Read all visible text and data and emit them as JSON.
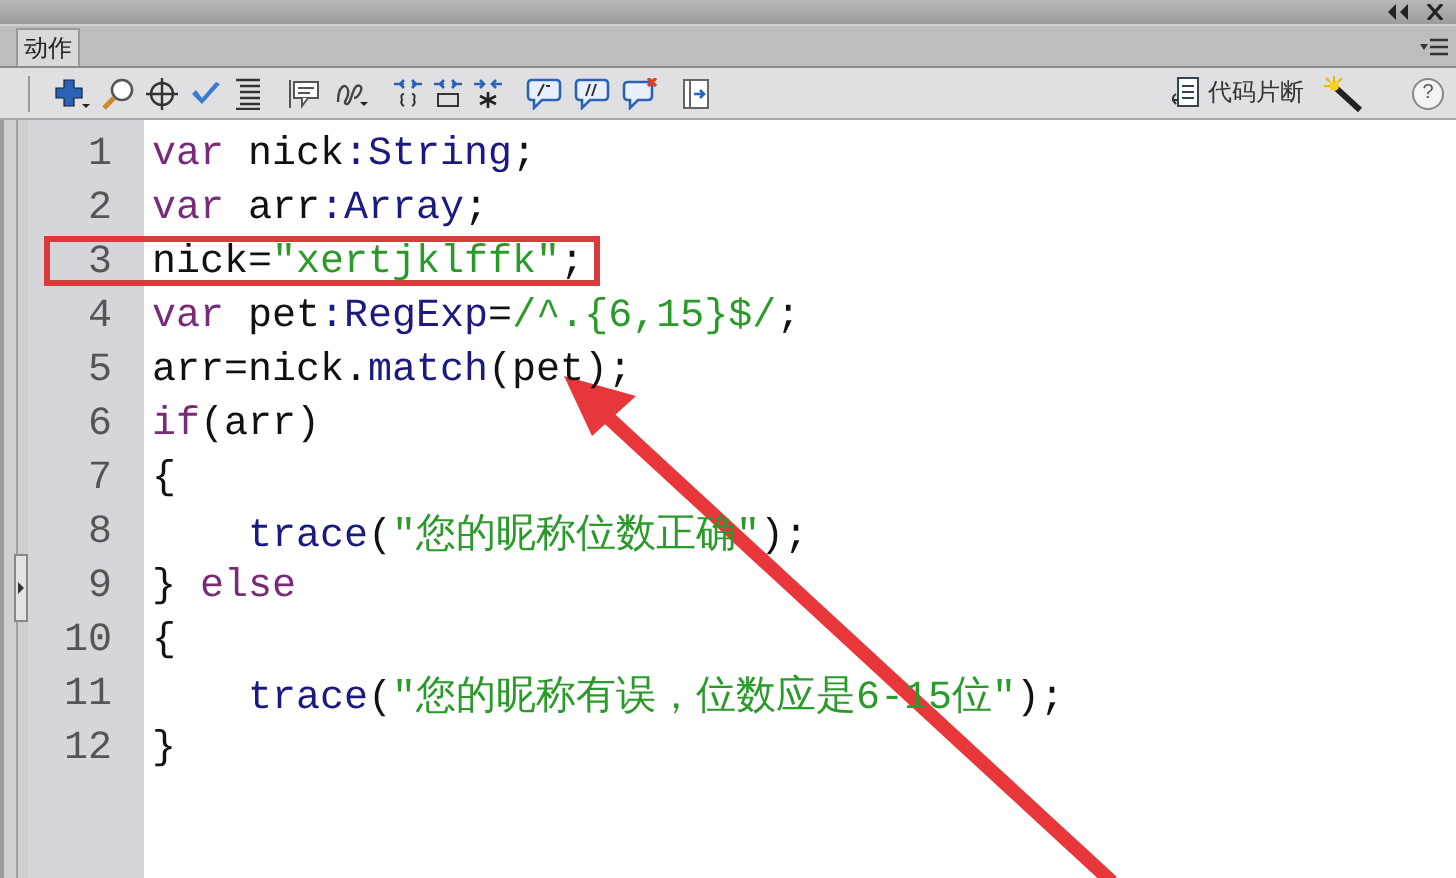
{
  "panel": {
    "tab": {
      "label": "动作",
      "selected": true
    }
  },
  "toolbar": {
    "snippets_label": "代码片断",
    "help_label": "?"
  },
  "code": {
    "lines": [
      {
        "number": "1",
        "indent": false,
        "highlight": false,
        "tokens": [
          {
            "kind": "keyword",
            "text": "var"
          },
          {
            "kind": "plain",
            "text": " nick"
          },
          {
            "kind": "type",
            "text": ":String"
          },
          {
            "kind": "plain",
            "text": ";"
          }
        ]
      },
      {
        "number": "2",
        "indent": false,
        "highlight": false,
        "tokens": [
          {
            "kind": "keyword",
            "text": "var"
          },
          {
            "kind": "plain",
            "text": " arr"
          },
          {
            "kind": "type",
            "text": ":Array"
          },
          {
            "kind": "plain",
            "text": ";"
          }
        ]
      },
      {
        "number": "3",
        "indent": false,
        "highlight": true,
        "tokens": [
          {
            "kind": "plain",
            "text": "nick="
          },
          {
            "kind": "string",
            "text": "\"xertjklffk\""
          },
          {
            "kind": "plain",
            "text": ";"
          }
        ]
      },
      {
        "number": "4",
        "indent": false,
        "highlight": false,
        "tokens": [
          {
            "kind": "keyword",
            "text": "var"
          },
          {
            "kind": "plain",
            "text": " pet"
          },
          {
            "kind": "type",
            "text": ":RegExp"
          },
          {
            "kind": "plain",
            "text": "="
          },
          {
            "kind": "string",
            "text": "/^.{6,15}$/"
          },
          {
            "kind": "plain",
            "text": ";"
          }
        ]
      },
      {
        "number": "5",
        "indent": false,
        "highlight": false,
        "tokens": [
          {
            "kind": "plain",
            "text": "arr=nick."
          },
          {
            "kind": "type",
            "text": "match"
          },
          {
            "kind": "plain",
            "text": "(pet);"
          }
        ]
      },
      {
        "number": "6",
        "indent": false,
        "highlight": false,
        "tokens": [
          {
            "kind": "keyword",
            "text": "if"
          },
          {
            "kind": "plain",
            "text": "(arr)"
          }
        ]
      },
      {
        "number": "7",
        "indent": false,
        "highlight": false,
        "tokens": [
          {
            "kind": "plain",
            "text": "{"
          }
        ]
      },
      {
        "number": "8",
        "indent": true,
        "highlight": false,
        "tokens": [
          {
            "kind": "type",
            "text": "trace"
          },
          {
            "kind": "plain",
            "text": "("
          },
          {
            "kind": "string",
            "text": "\"您的昵称位数正确\""
          },
          {
            "kind": "plain",
            "text": ");"
          }
        ]
      },
      {
        "number": "9",
        "indent": false,
        "highlight": false,
        "tokens": [
          {
            "kind": "plain",
            "text": "} "
          },
          {
            "kind": "keyword",
            "text": "else"
          }
        ]
      },
      {
        "number": "10",
        "indent": false,
        "highlight": false,
        "tokens": [
          {
            "kind": "plain",
            "text": "{"
          }
        ]
      },
      {
        "number": "11",
        "indent": true,
        "highlight": false,
        "tokens": [
          {
            "kind": "type",
            "text": "trace"
          },
          {
            "kind": "plain",
            "text": "("
          },
          {
            "kind": "string",
            "text": "\"您的昵称有误，位数应是6-15位\""
          },
          {
            "kind": "plain",
            "text": ");"
          }
        ]
      },
      {
        "number": "12",
        "indent": false,
        "highlight": false,
        "tokens": [
          {
            "kind": "plain",
            "text": "}"
          }
        ]
      }
    ]
  }
}
